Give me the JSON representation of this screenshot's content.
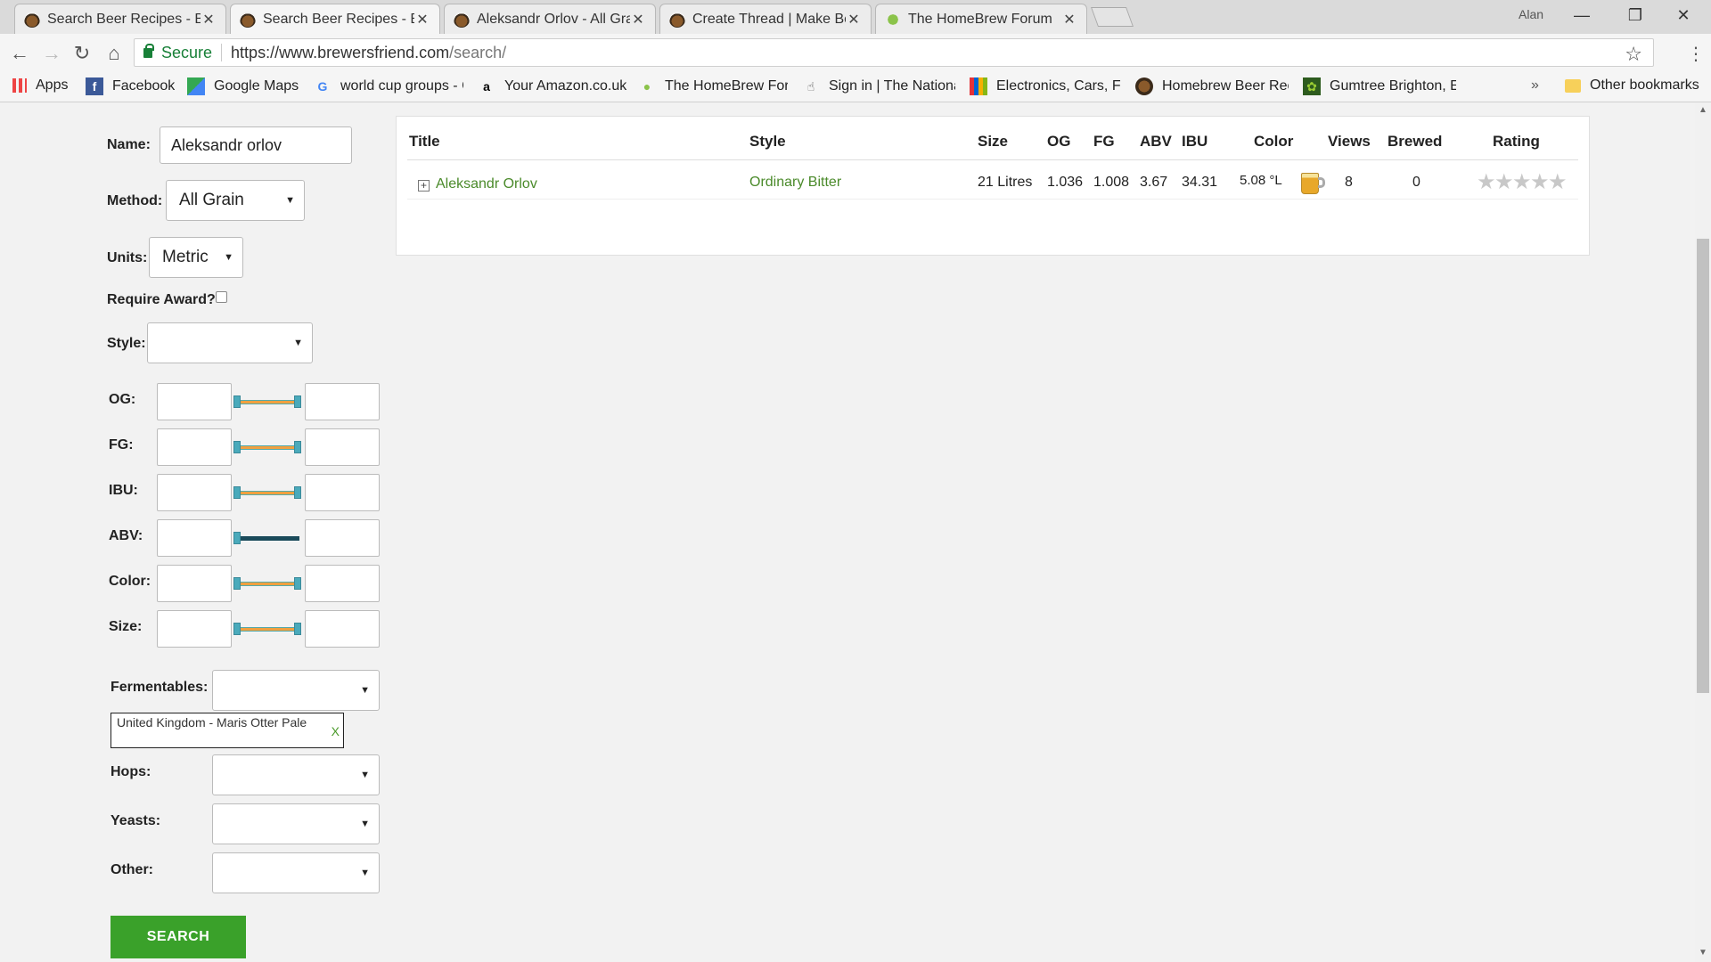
{
  "browser": {
    "tabs": [
      {
        "label": "Search Beer Recipes - Bre",
        "icon": "beer-favicon",
        "active": false
      },
      {
        "label": "Search Beer Recipes - Bre",
        "icon": "beer-favicon",
        "active": true
      },
      {
        "label": "Aleksandr Orlov - All Grai",
        "icon": "beer-favicon",
        "active": false
      },
      {
        "label": "Create Thread | Make Bee",
        "icon": "beer-favicon",
        "active": false
      },
      {
        "label": "The HomeBrew Forum",
        "icon": "leaf-favicon",
        "active": false
      }
    ],
    "profile_name": "Alan",
    "address": {
      "secure_label": "Secure",
      "url_host": "https://www.brewersfriend.com",
      "url_path": "/search/"
    },
    "bookmarks": [
      {
        "label": "Apps",
        "icon": "apps-grid-icon"
      },
      {
        "label": "Facebook",
        "icon": "facebook-icon"
      },
      {
        "label": "Google Maps",
        "icon": "google-maps-icon"
      },
      {
        "label": "world cup groups - G",
        "icon": "google-icon"
      },
      {
        "label": "Your Amazon.co.uk",
        "icon": "amazon-icon"
      },
      {
        "label": "The HomeBrew Foru",
        "icon": "leaf-icon"
      },
      {
        "label": "Sign in | The Nationa",
        "icon": "hand-icon"
      },
      {
        "label": "Electronics, Cars, Fas",
        "icon": "ebay-icon"
      },
      {
        "label": "Homebrew Beer Rec",
        "icon": "beer-icon"
      },
      {
        "label": "Gumtree Brighton, E",
        "icon": "gumtree-icon"
      }
    ],
    "bookmarks_overflow": "»",
    "other_bookmarks": "Other bookmarks"
  },
  "search_form": {
    "name_label": "Name:",
    "name_value": "Aleksandr orlov",
    "method_label": "Method:",
    "method_value": "All Grain",
    "units_label": "Units:",
    "units_value": "Metric",
    "require_award_label": "Require Award?",
    "require_award_checked": false,
    "style_label": "Style:",
    "style_value": "",
    "ranges": [
      {
        "label": "OG:",
        "slider": "og-range-slider"
      },
      {
        "label": "FG:",
        "slider": "fg-range-slider"
      },
      {
        "label": "IBU:",
        "slider": "ibu-range-slider"
      },
      {
        "label": "ABV:",
        "slider": "abv-range-slider"
      },
      {
        "label": "Color:",
        "slider": "color-range-slider"
      },
      {
        "label": "Size:",
        "slider": "size-range-slider"
      }
    ],
    "fermentables_label": "Fermentables:",
    "fermentable_tag": "United Kingdom - Maris Otter Pale",
    "tag_remove": "X",
    "hops_label": "Hops:",
    "yeasts_label": "Yeasts:",
    "other_label": "Other:",
    "search_button": "SEARCH"
  },
  "results": {
    "headers": [
      "Title",
      "Style",
      "Size",
      "OG",
      "FG",
      "ABV",
      "IBU",
      "Color",
      "Views",
      "Brewed",
      "Rating"
    ],
    "rows": [
      {
        "expand": "+",
        "title": "Aleksandr Orlov",
        "style": "Ordinary Bitter",
        "size": "21 Litres",
        "og": "1.036",
        "fg": "1.008",
        "abv": "3.67",
        "ibu": "34.31",
        "color": "5.08 °L",
        "views": "8",
        "brewed": "0",
        "rating_stars": 0,
        "rating_max": 5
      }
    ]
  },
  "colors": {
    "accent_green": "#3aa12a",
    "link_green": "#4a8a2a"
  }
}
